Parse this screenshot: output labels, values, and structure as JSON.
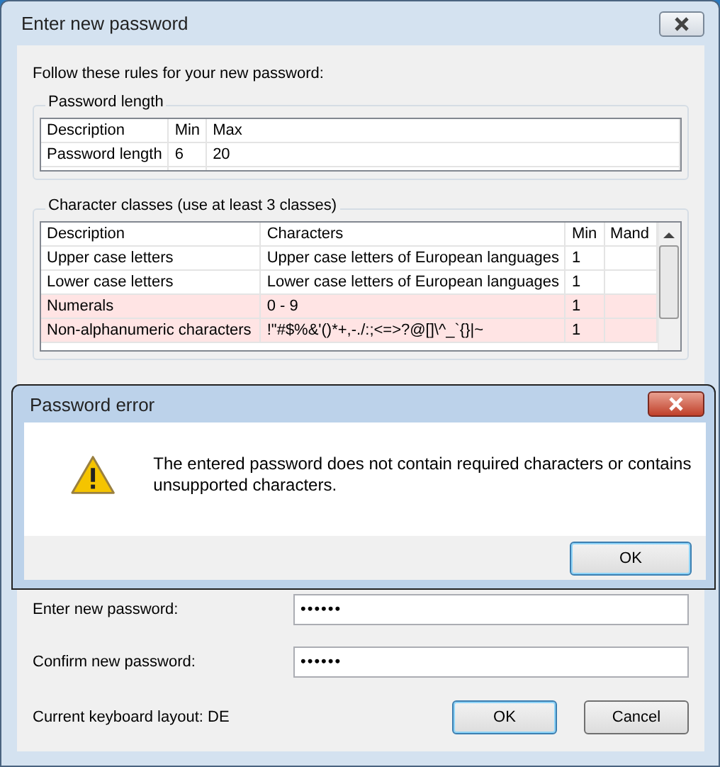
{
  "window": {
    "title": "Enter new password"
  },
  "instruction": "Follow these rules for your new password:",
  "length_group": {
    "title": "Password length",
    "columns": [
      "Description",
      "Min",
      "Max"
    ],
    "rows": [
      [
        "Password length",
        "6",
        "20"
      ]
    ]
  },
  "classes_group": {
    "title": "Character classes (use at least 3 classes)",
    "columns": [
      "Description",
      "Characters",
      "Min",
      "Mand"
    ],
    "rows": [
      {
        "cells": [
          "Upper case letters",
          "Upper case letters of European languages",
          "1"
        ],
        "highlighted": false
      },
      {
        "cells": [
          "Lower case letters",
          "Lower case letters of European languages",
          "1"
        ],
        "highlighted": false
      },
      {
        "cells": [
          "Numerals",
          "0 - 9",
          "1"
        ],
        "highlighted": true
      },
      {
        "cells": [
          "Non-alphanumeric characters",
          "!\"#$%&'()*+,-./:;<=>?@[]\\^_`{}|~",
          "1"
        ],
        "highlighted": true
      }
    ]
  },
  "fields": [
    {
      "label": "Enter new password:",
      "value": "••••••"
    },
    {
      "label": "Confirm new password:",
      "value": "••••••"
    }
  ],
  "keyboard_layout": "Current keyboard layout: DE",
  "buttons": [
    {
      "label": "OK",
      "default": true
    },
    {
      "label": "Cancel",
      "default": false
    }
  ],
  "error_dialog": {
    "title": "Password error",
    "message": "The entered password does not contain required characters or contains unsupported characters.",
    "button": "OK"
  }
}
